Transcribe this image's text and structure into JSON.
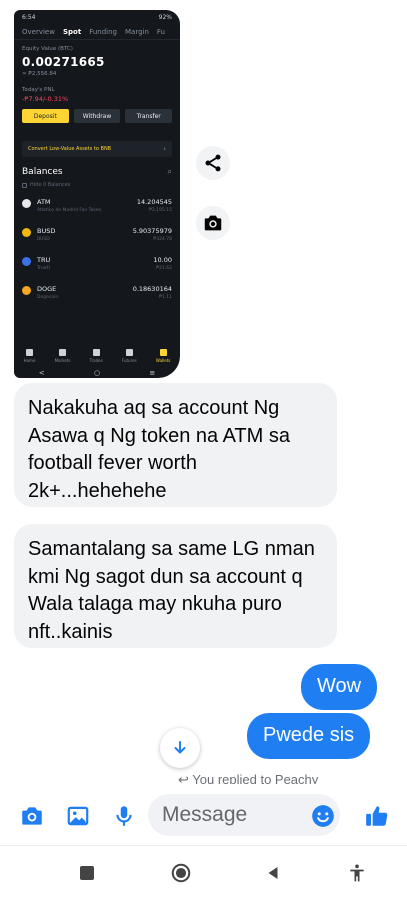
{
  "colors": {
    "messenger_blue": "#1f7ef2",
    "incoming_bubble": "#f1f2f4",
    "binance_yellow": "#fcd535",
    "binance_bg": "#14171c",
    "loss_red": "#f6465d"
  },
  "shared_screenshot": {
    "status_time": "6:54",
    "status_right": "92%",
    "tabs": [
      "Overview",
      "Spot",
      "Funding",
      "Margin",
      "Fu"
    ],
    "active_tab": "Spot",
    "equity_label": "Equity Value (BTC)",
    "equity_value": "0.00271665",
    "equity_usd": "≈ ₱2,556.84",
    "pnl_label": "Today's PNL",
    "pnl_value": "-₱7.94/-0.31%",
    "buttons": {
      "deposit": "Deposit",
      "withdraw": "Withdraw",
      "transfer": "Transfer"
    },
    "convert_banner": "Convert Low-Value Assets to BNB",
    "balances_title": "Balances",
    "hide_small": "Hide 0 Balances",
    "coins": [
      {
        "symbol": "ATM",
        "name": "Atletico de Madrid Fan Token",
        "amount": "14.204545",
        "fiat": "₱2,195.15",
        "icon_color": "#e6e8ea"
      },
      {
        "symbol": "BUSD",
        "name": "BUSD",
        "amount": "5.90375979",
        "fiat": "₱324.78",
        "icon_color": "#f0b90b"
      },
      {
        "symbol": "TRU",
        "name": "TrueFi",
        "amount": "10.00",
        "fiat": "₱21.62",
        "icon_color": "#3a73e8"
      },
      {
        "symbol": "DOGE",
        "name": "Dogecoin",
        "amount": "0.18630164",
        "fiat": "₱1.11",
        "icon_color": "#f5a623"
      }
    ],
    "bottom_nav": [
      "Home",
      "Markets",
      "Trades",
      "Futures",
      "Wallets"
    ],
    "bottom_nav_active": "Wallets",
    "system_nav": [
      "<",
      "○",
      "≡"
    ]
  },
  "side_actions": {
    "share_icon": "share-icon",
    "camera_icon": "camera-icon"
  },
  "messages": {
    "incoming": [
      "Nakakuha aq sa account Ng Asawa q Ng token na ATM sa football fever worth 2k+...hehehehe",
      "Samantalang sa same LG nman kmi Ng sagot dun sa account q Wala talaga may nkuha puro nft..kainis"
    ],
    "outgoing": [
      "Wow",
      "Pwede sis"
    ]
  },
  "reply_note": "↩ You replied to Peachy",
  "composer": {
    "placeholder": "Message",
    "icons": [
      "camera-icon",
      "gallery-icon",
      "microphone-icon",
      "emoji-icon",
      "like-icon"
    ]
  },
  "system_bar": [
    "recents-icon",
    "home-icon",
    "back-icon",
    "accessibility-icon"
  ]
}
